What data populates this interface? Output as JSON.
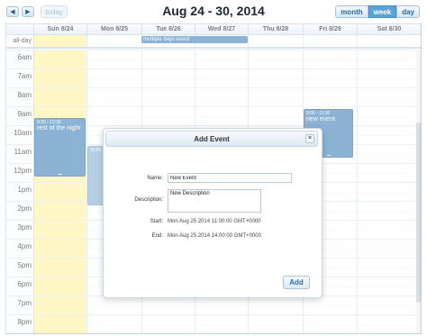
{
  "toolbar": {
    "prev_icon": "◀",
    "next_icon": "▶",
    "today": "today",
    "title": "Aug 24 - 30, 2014",
    "views": [
      "month",
      "week",
      "day"
    ],
    "active_view": "week"
  },
  "calendar": {
    "allday_label": "all-day",
    "days": [
      "Sun 8/24",
      "Mon 8/25",
      "Tue 8/26",
      "Wed 8/27",
      "Thu 8/28",
      "Fri 8/29",
      "Sat 8/30"
    ],
    "hours": [
      "6am",
      "7am",
      "8am",
      "9am",
      "10am",
      "11am",
      "12pm",
      "1pm",
      "2pm",
      "3pm",
      "4pm",
      "5pm",
      "6pm",
      "7pm",
      "8pm"
    ],
    "events": {
      "allday": {
        "title": "multiple days event"
      },
      "sun": {
        "time": "9:30 - 12:30",
        "title": "rest of the night"
      },
      "mon": {
        "time": "11:00"
      },
      "fri": {
        "time": "9:00 - 11:30",
        "title": "new event"
      }
    },
    "colors": {
      "event": "#4f8bbd",
      "today": "#fff3a8"
    }
  },
  "dialog": {
    "title": "Add Event",
    "close_icon": "×",
    "name_label": "Name:",
    "name_value": "New Event",
    "description_label": "Description:",
    "description_value": "New Description",
    "start_label": "Start:",
    "start_value": "Mon Aug 25 2014 11:00:00 GMT+0000",
    "end_label": "End:",
    "end_value": "Mon Aug 25 2014 14:00:00 GMT+0000",
    "add_button": "Add"
  }
}
